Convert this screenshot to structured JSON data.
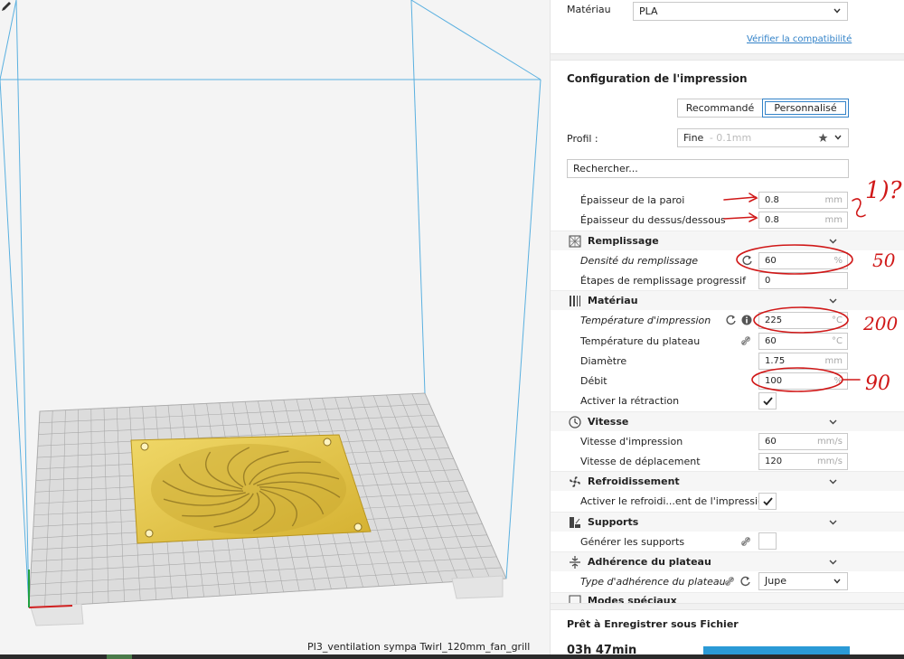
{
  "viewport": {
    "filename": "PI3_ventilation sympa Twirl_120mm_fan_grill",
    "pencil_icon": "pencil-icon"
  },
  "colors": {
    "accent": "#3282c8",
    "model": "#e8c848",
    "build_volume": "#5ab0e0",
    "annotation": "#d01818",
    "print_button": "#2b9ad6"
  },
  "material": {
    "label": "Matériau",
    "value": "PLA",
    "check_link": "Vérifier la compatibilité"
  },
  "print_setup": {
    "title": "Configuration de l'impression",
    "tab_recommended": "Recommandé",
    "tab_custom": "Personnalisé",
    "profile_label": "Profil :",
    "profile_value": "Fine",
    "profile_sub": "- 0.1mm",
    "search_placeholder": "Rechercher..."
  },
  "settings": {
    "wall_thickness": {
      "label": "Épaisseur de la paroi",
      "value": "0.8",
      "unit": "mm"
    },
    "top_bottom_thickness": {
      "label": "Épaisseur du dessus/dessous",
      "value": "0.8",
      "unit": "mm"
    },
    "infill": {
      "title": "Remplissage",
      "density": {
        "label": "Densité du remplissage",
        "value": "60",
        "unit": "%"
      },
      "gradual": {
        "label": "Étapes de remplissage progressif",
        "value": "0"
      }
    },
    "material": {
      "title": "Matériau",
      "print_temp": {
        "label": "Température d'impression",
        "value": "225",
        "unit": "°C"
      },
      "bed_temp": {
        "label": "Température du plateau",
        "value": "60",
        "unit": "°C"
      },
      "diameter": {
        "label": "Diamètre",
        "value": "1.75",
        "unit": "mm"
      },
      "flow": {
        "label": "Débit",
        "value": "100",
        "unit": "%"
      },
      "retraction": {
        "label": "Activer la rétraction",
        "checked": true
      }
    },
    "speed": {
      "title": "Vitesse",
      "print_speed": {
        "label": "Vitesse d'impression",
        "value": "60",
        "unit": "mm/s"
      },
      "travel_speed": {
        "label": "Vitesse de déplacement",
        "value": "120",
        "unit": "mm/s"
      }
    },
    "cooling": {
      "title": "Refroidissement",
      "enable": {
        "label": "Activer le refroidi...ent de l'impression",
        "checked": true
      }
    },
    "supports": {
      "title": "Supports",
      "generate": {
        "label": "Générer les supports",
        "checked": false
      }
    },
    "adhesion": {
      "title": "Adhérence du plateau",
      "type": {
        "label": "Type d'adhérence du plateau",
        "value": "Jupe"
      }
    },
    "special": {
      "title": "Modes spéciaux"
    }
  },
  "footer": {
    "status": "Prêt à Enregistrer sous Fichier",
    "time": "03h 47min"
  },
  "annotations": {
    "note1": "1)?",
    "note_infill": "50",
    "note_temp": "200",
    "note_flow": "90"
  }
}
